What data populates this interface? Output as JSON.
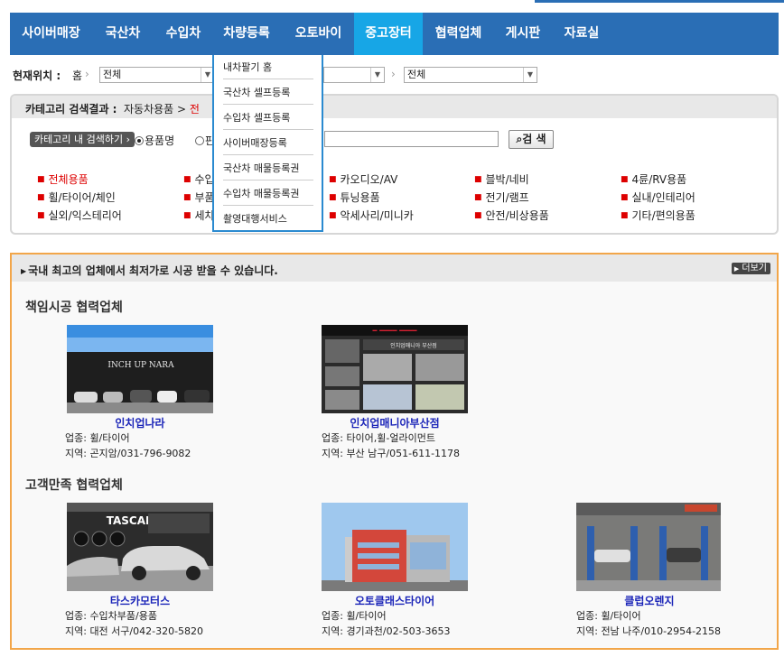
{
  "nav": {
    "items": [
      "사이버매장",
      "국산차",
      "수입차",
      "차량등록",
      "오토바이",
      "중고장터",
      "협력업체",
      "게시판",
      "자료실"
    ],
    "active_index": 5
  },
  "dropdown": {
    "items": [
      "내차팔기 홈",
      "국산차 셀프등록",
      "수입차 셀프등록",
      "사이버매장등록",
      "국산차 매물등록권",
      "수입차 매물등록권",
      "촬영대행서비스"
    ]
  },
  "location": {
    "label": "현재위치 :",
    "home": "홈",
    "select1": "전체",
    "select3": "전체"
  },
  "category": {
    "title": "카테고리 검색결과 :",
    "path_prefix": "자동차용품 >",
    "path_current": "전",
    "inner_search_label": "카테고리 내 검색하기",
    "radio1": "용품명",
    "radio2": "판",
    "search_button": "검 색",
    "columns": [
      [
        "전체용품",
        "휠/타이어/체인",
        "실외/익스테리어"
      ],
      [
        "수입",
        "부품",
        "세차"
      ],
      [
        "카오디오/AV",
        "튜닝용품",
        "악세사리/미니카"
      ],
      [
        "블박/네비",
        "전기/램프",
        "안전/비상용품"
      ],
      [
        "4륜/RV용품",
        "실내/인테리어",
        "기타/편의용품"
      ]
    ]
  },
  "partners": {
    "headline": "국내 최고의 업체에서 최저가로 시공 받을 수 있습니다.",
    "more": "더보기",
    "section1": "책임시공 협력업체",
    "section2": "고객만족 협력업체",
    "cards1": [
      {
        "name": "인치업나라",
        "type": "업종: 휠/타이어",
        "region": "지역: 곤지암/031-796-9082",
        "sign": "INCH UP NARA"
      },
      {
        "name": "인치업매니아부산점",
        "type": "업종: 타이어,휠-얼라이먼트",
        "region": "지역: 부산 남구/051-611-1178",
        "sign": "인치업매니아 부산점"
      }
    ],
    "cards2": [
      {
        "name": "타스카모터스",
        "type": "업종: 수입차부품/용품",
        "region": "지역: 대전 서구/042-320-5820",
        "sign": "TASCAR"
      },
      {
        "name": "오토클래스타이어",
        "type": "업종: 휠/타이어",
        "region": "지역: 경기과천/02-503-3653",
        "sign": ""
      },
      {
        "name": "클럽오렌지",
        "type": "업종: 휠/타이어",
        "region": "지역: 전남 나주/010-2954-2158",
        "sign": ""
      }
    ]
  },
  "colors": {
    "nav_bg": "#2a6eb5",
    "nav_active": "#17a6e6",
    "partner_border": "#f2a64a",
    "partner_name": "#1a24b8",
    "accent_red": "#dd0000"
  }
}
